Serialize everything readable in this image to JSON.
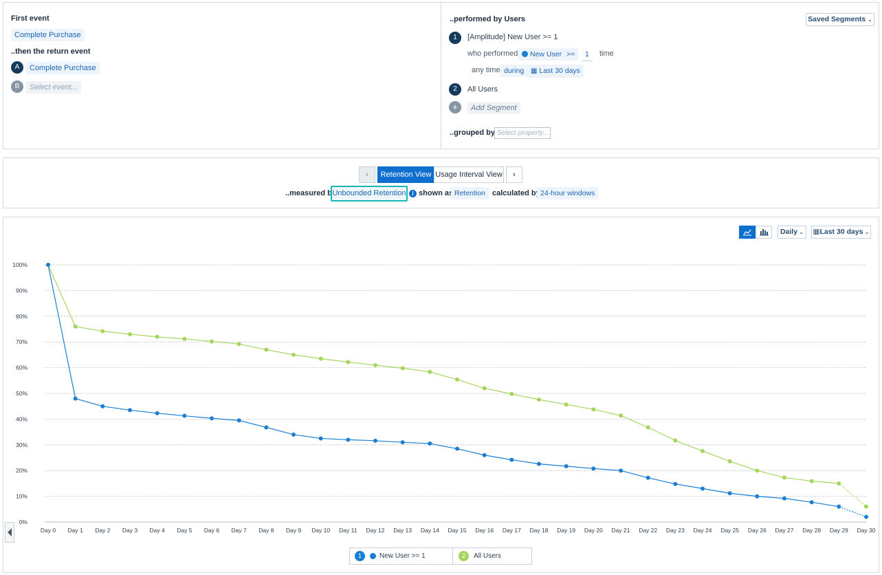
{
  "events": {
    "first_event_label": "First event",
    "first_event": "Complete Purchase",
    "return_event_label": "..then the return event",
    "return_events": [
      {
        "badge": "A",
        "name": "Complete Purchase"
      },
      {
        "badge": "B",
        "placeholder": "Select event..."
      }
    ]
  },
  "segments": {
    "header": "..performed by Users",
    "saved_segments": "Saved Segments",
    "items": [
      {
        "badge": "1",
        "name": "[Amplitude] New User >= 1"
      },
      {
        "badge": "2",
        "name": "All Users"
      }
    ],
    "condition": {
      "who_performed": "who performed",
      "event": "New User",
      "operator": ">=",
      "count": "1",
      "unit": "time",
      "any_time": "any time",
      "during": "during",
      "range": "Last 30 days"
    },
    "add_segment": "Add Segment",
    "grouped_by": "..grouped by",
    "grouped_placeholder": "Select property..."
  },
  "view": {
    "retention_view": "Retention View",
    "usage_interval_view": "Usage Interval View",
    "measured_by": "..measured by",
    "measure": "Unbounded Retention",
    "shown_as": "shown as",
    "shown_value": "Retention",
    "calculated_by": "calculated by",
    "calc_value": "24-hour windows"
  },
  "chart_controls": {
    "interval": "Daily",
    "range": "Last 30 days"
  },
  "colors": {
    "series1": "#1a7ed2",
    "series2": "#a4d65e",
    "accent": "#0f6fcf"
  },
  "chart_data": {
    "type": "line",
    "categories": [
      "Day 0",
      "Day 1",
      "Day 2",
      "Day 3",
      "Day 4",
      "Day 5",
      "Day 6",
      "Day 7",
      "Day 8",
      "Day 9",
      "Day 10",
      "Day 11",
      "Day 12",
      "Day 13",
      "Day 14",
      "Day 15",
      "Day 16",
      "Day 17",
      "Day 18",
      "Day 19",
      "Day 20",
      "Day 21",
      "Day 22",
      "Day 23",
      "Day 24",
      "Day 25",
      "Day 26",
      "Day 27",
      "Day 28",
      "Day 29",
      "Day 30"
    ],
    "y_ticks": [
      "0%",
      "10%",
      "20%",
      "30%",
      "40%",
      "50%",
      "60%",
      "70%",
      "80%",
      "90%",
      "100%"
    ],
    "ylim": [
      0,
      100
    ],
    "grid": true,
    "legend_position": "bottom-center",
    "series": [
      {
        "badge": "1",
        "name": "New User >= 1",
        "values": [
          100,
          48,
          45,
          43.5,
          42.3,
          41.3,
          40.3,
          39.5,
          36.8,
          34,
          32.5,
          32,
          31.6,
          31,
          30.5,
          28.5,
          26,
          24.2,
          22.6,
          21.7,
          20.8,
          20,
          17.2,
          14.8,
          13,
          11.2,
          10,
          9.2,
          7.7,
          6,
          2
        ]
      },
      {
        "badge": "2",
        "name": "All Users",
        "values": [
          100,
          76,
          74.2,
          73,
          72,
          71.2,
          70.2,
          69.2,
          67,
          65,
          63.5,
          62.2,
          61,
          59.8,
          58.4,
          55.4,
          52,
          49.8,
          47.6,
          45.7,
          43.8,
          41.4,
          36.8,
          31.7,
          27.6,
          23.6,
          20,
          17.3,
          15.9,
          15,
          6
        ]
      }
    ]
  }
}
